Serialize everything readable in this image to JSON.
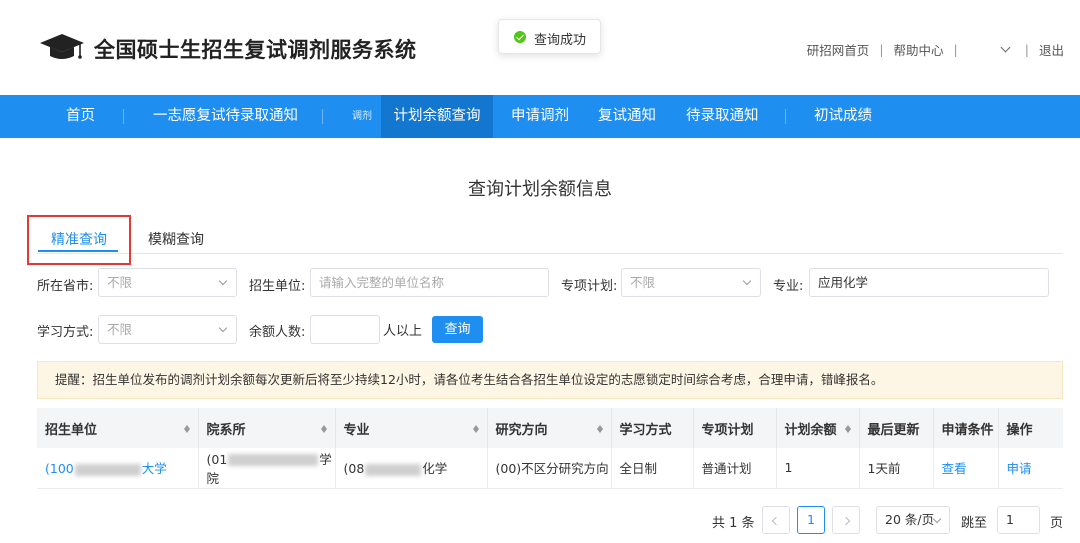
{
  "header": {
    "site_title": "全国硕士生招生复试调剂服务系统",
    "toast": "查询成功",
    "links": [
      "研招网首页",
      "帮助中心",
      "退出"
    ]
  },
  "nav": {
    "items": [
      "首页",
      "一志愿复试待录取通知",
      "计划余额查询",
      "申请调剂",
      "复试通知",
      "待录取通知",
      "初试成绩"
    ],
    "small_label": "调剂",
    "active": "计划余额查询"
  },
  "page_title": "查询计划余额信息",
  "tabs": [
    "精准查询",
    "模糊查询"
  ],
  "filters": {
    "province_label": "所在省市:",
    "province_value": "不限",
    "unit_label": "招生单位:",
    "unit_placeholder": "请输入完整的单位名称",
    "special_label": "专项计划:",
    "special_value": "不限",
    "major_label": "专业:",
    "major_value": "应用化学",
    "mode_label": "学习方式:",
    "mode_value": "不限",
    "remain_label": "余额人数:",
    "remain_suffix": "人以上",
    "query_button": "查询"
  },
  "notice": "提醒：招生单位发布的调剂计划余额每次更新后将至少持续12小时，请各位考生结合各招生单位设定的志愿锁定时间综合考虑，合理申请，错峰报名。",
  "table": {
    "headers": [
      "招生单位",
      "院系所",
      "专业",
      "研究方向",
      "学习方式",
      "专项计划",
      "计划余额",
      "最后更新",
      "申请条件",
      "操作"
    ],
    "row": {
      "unit_prefix": "(100",
      "unit_suffix": "大学",
      "dept_prefix": "(01",
      "dept_suffix": "学院",
      "major_prefix": "(08",
      "major_suffix": "化学",
      "direction": "(00)不区分研究方向",
      "mode": "全日制",
      "special": "普通计划",
      "remain": "1",
      "updated": "1天前",
      "condition": "查看",
      "action": "申请"
    }
  },
  "pagination": {
    "total": "共 1 条",
    "current_page": "1",
    "page_size": "20 条/页",
    "jump_label": "跳至",
    "jump_value": "1",
    "page_suffix": "页"
  },
  "colors": {
    "brand_blue": "#1f8ef1",
    "nav_active": "#1477cf",
    "highlight_red": "#e53935",
    "notice_bg": "#fdf6e4"
  }
}
